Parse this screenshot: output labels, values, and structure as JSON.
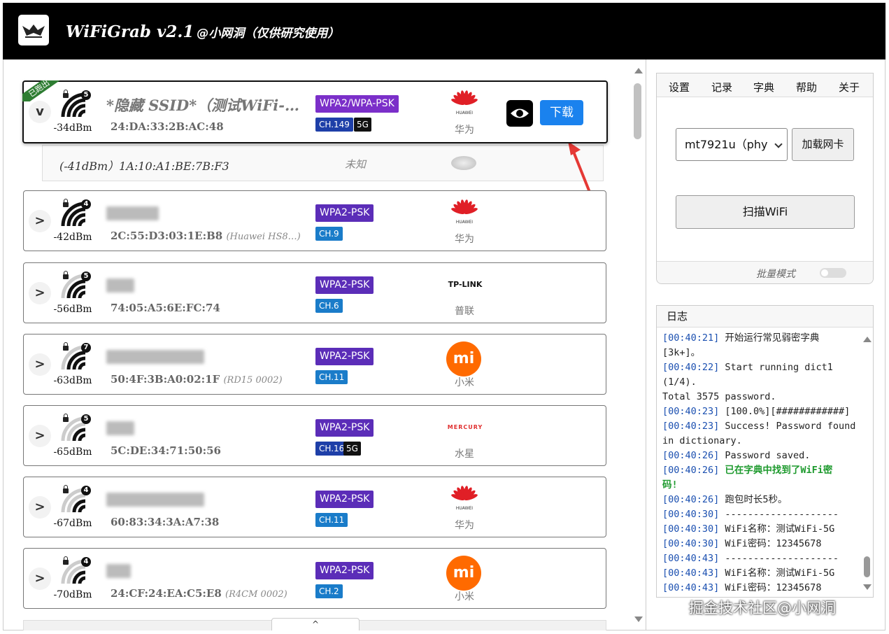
{
  "app": {
    "title": "WiFiGrab v2.1",
    "subtitle": "@小网洞（仅供研究使用）"
  },
  "networks": [
    {
      "ssid": "*隐藏 SSID*（测试WiFi-…",
      "mac": "24:DA:33:2B:AC:48",
      "model": "",
      "dbm": "-34dBm",
      "clients": "5",
      "enc": "WPA2/WPA-PSK",
      "channel": "CH.149",
      "band": "5G",
      "vendor": "华为",
      "vendor_logo": "huawei-logo",
      "toggle": "v",
      "ribbon": "已跑出",
      "download": "下载",
      "signal_bars": 4
    },
    {
      "ssid": "",
      "mac": "2C:55:D3:03:1E:B8",
      "model": "(Huawei HS8…)",
      "dbm": "-42dBm",
      "clients": "4",
      "enc": "WPA2-PSK",
      "channel": "CH.9",
      "band": "",
      "vendor": "华为",
      "vendor_logo": "huawei-logo",
      "toggle": ">",
      "signal_bars": 4
    },
    {
      "ssid": "",
      "mac": "74:05:A5:6E:FC:74",
      "model": "",
      "dbm": "-56dBm",
      "clients": "5",
      "enc": "WPA2-PSK",
      "channel": "CH.6",
      "band": "",
      "vendor": "普联",
      "vendor_logo": "tplink-logo",
      "vendor_logo_text": "TP-LINK",
      "toggle": ">",
      "signal_bars": 3
    },
    {
      "ssid": "",
      "mac": "50:4F:3B:A0:02:1F",
      "model": "(RD15 0002)",
      "dbm": "-63dBm",
      "clients": "7",
      "enc": "WPA2-PSK",
      "channel": "CH.11",
      "band": "",
      "vendor": "小米",
      "vendor_logo": "xiaomi-logo",
      "vendor_logo_text": "mi",
      "toggle": ">",
      "signal_bars": 3
    },
    {
      "ssid": "",
      "mac": "5C:DE:34:71:50:56",
      "model": "",
      "dbm": "-65dBm",
      "clients": "5",
      "enc": "WPA2-PSK",
      "channel": "CH.161",
      "band": "5G",
      "vendor": "水星",
      "vendor_logo": "mercury-logo",
      "vendor_logo_text": "MERCURY",
      "toggle": ">",
      "signal_bars": 2
    },
    {
      "ssid": "",
      "mac": "60:83:34:3A:A7:38",
      "model": "",
      "dbm": "-67dBm",
      "clients": "4",
      "enc": "WPA2-PSK",
      "channel": "CH.11",
      "band": "",
      "vendor": "华为",
      "vendor_logo": "huawei-logo",
      "toggle": ">",
      "signal_bars": 2
    },
    {
      "ssid": "",
      "mac": "24:CF:24:EA:C5:E8",
      "model": "(R4CM 0002)",
      "dbm": "-70dBm",
      "clients": "4",
      "enc": "WPA2-PSK",
      "channel": "CH.2",
      "band": "",
      "vendor": "小米",
      "vendor_logo": "xiaomi-logo",
      "vendor_logo_text": "mi",
      "toggle": ">",
      "signal_bars": 2
    }
  ],
  "client_row": {
    "text": "(-41dBm）1A:10:A1:BE:7B:F3",
    "vendor": "未知"
  },
  "menu": [
    "设置",
    "记录",
    "字典",
    "帮助",
    "关于"
  ],
  "adapter": {
    "selected": "mt7921u（phy",
    "load_label": "加载网卡"
  },
  "scan_label": "扫描WiFi",
  "batch_label": "批量模式",
  "log": {
    "title": "日志",
    "lines": [
      {
        "ts": "[00:40:21]",
        "text": " 开始运行常见弱密字典"
      },
      {
        "ts": "",
        "text": "[3k+]。"
      },
      {
        "ts": "[00:40:22]",
        "text": " Start running dict1"
      },
      {
        "ts": "",
        "text": "(1/4)."
      },
      {
        "ts": "",
        "text": "Total 3575 password."
      },
      {
        "ts": "[00:40:23]",
        "text": " [100.0%][############]"
      },
      {
        "ts": "[00:40:23]",
        "text": " Success! Password found"
      },
      {
        "ts": "",
        "text": "in dictionary."
      },
      {
        "ts": "[00:40:26]",
        "text": " Password saved."
      },
      {
        "ts": "[00:40:26]",
        "text": " 已在字典中找到了WiFi密",
        "green": true
      },
      {
        "ts": "",
        "text": "码!",
        "green": true
      },
      {
        "ts": "[00:40:26]",
        "text": " 跑包时长5秒。"
      },
      {
        "ts": "[00:40:30]",
        "text": " --------------------"
      },
      {
        "ts": "[00:40:30]",
        "text": " WiFi名称：测试WiFi-5G"
      },
      {
        "ts": "[00:40:30]",
        "text": " WiFi密码：12345678"
      },
      {
        "ts": "[00:40:43]",
        "text": " --------------------"
      },
      {
        "ts": "[00:40:43]",
        "text": " WiFi名称：测试WiFi-5G"
      },
      {
        "ts": "[00:40:43]",
        "text": " WiFi密码：12345678"
      }
    ]
  },
  "watermark": "掘金技术社区@小网洞",
  "bottom_tab": "^",
  "colors": {
    "accent": "#1a82ee",
    "highlight": "#e53935",
    "enc_bg": "#5b2db8",
    "channel_bg": "#1a7cc9",
    "success": "#1e9a2e"
  }
}
